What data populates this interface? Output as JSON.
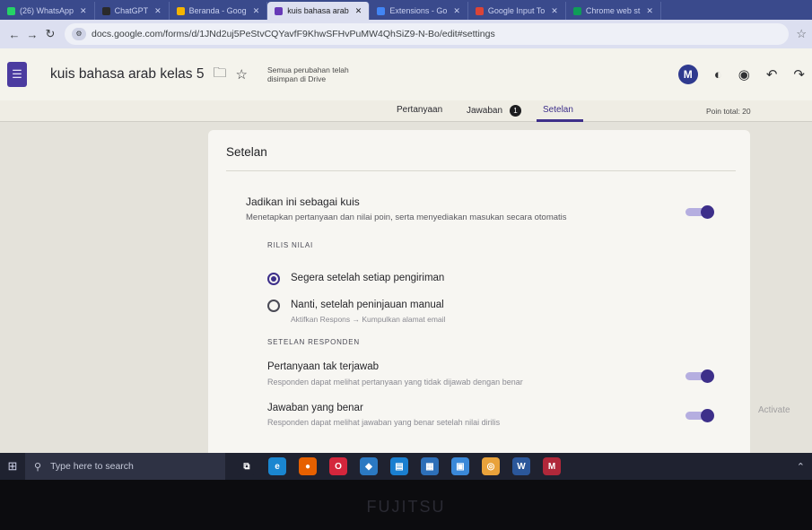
{
  "browser": {
    "tabs": [
      {
        "label": "(26) WhatsApp",
        "color": "#25d366",
        "active": false
      },
      {
        "label": "ChatGPT",
        "color": "#2a2a2a",
        "active": false
      },
      {
        "label": "Beranda - Goog",
        "color": "#f4b400",
        "active": false
      },
      {
        "label": "kuis bahasa arab",
        "color": "#673ab7",
        "active": true
      },
      {
        "label": "Extensions - Go",
        "color": "#4285f4",
        "active": false
      },
      {
        "label": "Google Input To",
        "color": "#db4437",
        "active": false
      },
      {
        "label": "Chrome web st",
        "color": "#0f9d58",
        "active": false
      }
    ],
    "tab_close": "✕",
    "back_glyph": "←",
    "forward_glyph": "→",
    "reload_glyph": "↻",
    "url": "docs.google.com/forms/d/1JNd2uj5PeStvCQYavfF9KhwSFHvPuMW4QhSiZ9-N-Bo/edit#settings"
  },
  "form_header": {
    "title": "kuis bahasa arab kelas 5",
    "save_status_line1": "Semua perubahan telah",
    "save_status_line2": "disimpan di Drive",
    "extension_badge": "M",
    "icons": [
      "folder-icon",
      "star-icon",
      "palette-icon",
      "preview-icon",
      "undo-icon",
      "redo-icon"
    ]
  },
  "form_tabs": {
    "questions": "Pertanyaan",
    "responses": "Jawaban",
    "responses_count": "1",
    "settings": "Setelan",
    "points_total": "Poin total: 20"
  },
  "settings_card": {
    "title": "Setelan",
    "quiz_toggle": {
      "label": "Jadikan ini sebagai kuis",
      "description": "Menetapkan pertanyaan dan nilai poin, serta menyediakan masukan secara otomatis",
      "on": true
    },
    "release_section": "RILIS NILAI",
    "release_options": [
      {
        "label": "Segera setelah setiap pengiriman",
        "sub": "",
        "selected": true
      },
      {
        "label": "Nanti, setelah peninjauan manual",
        "sub": "Aktifkan Respons → Kumpulkan alamat email",
        "selected": false
      }
    ],
    "respondent_section": "SETELAN RESPONDEN",
    "respondent_settings": [
      {
        "label": "Pertanyaan tak terjawab",
        "description": "Responden dapat melihat pertanyaan yang tidak dijawab dengan benar",
        "on": true
      },
      {
        "label": "Jawaban yang benar",
        "description": "Responden dapat melihat jawaban yang benar setelah nilai dirilis",
        "on": true
      }
    ]
  },
  "windows_watermark": "Activate",
  "taskbar": {
    "search_placeholder": "Type here to search",
    "apps": [
      {
        "name": "task-view-icon",
        "color": "#1f2230"
      },
      {
        "name": "edge-icon",
        "color": "#1a86d0"
      },
      {
        "name": "firefox-icon",
        "color": "#e66000"
      },
      {
        "name": "opera-icon",
        "color": "#d4263c"
      },
      {
        "name": "app-icon",
        "color": "#2b79c2"
      },
      {
        "name": "store-icon",
        "color": "#1a7fd0"
      },
      {
        "name": "calculator-icon",
        "color": "#2d6fb8"
      },
      {
        "name": "photos-icon",
        "color": "#3a88d8"
      },
      {
        "name": "chrome-icon",
        "color": "#e9a23b"
      },
      {
        "name": "word-icon",
        "color": "#2b579a"
      },
      {
        "name": "app-red-icon",
        "color": "#b0283a"
      }
    ]
  },
  "bezel_brand": "FUJITSU"
}
